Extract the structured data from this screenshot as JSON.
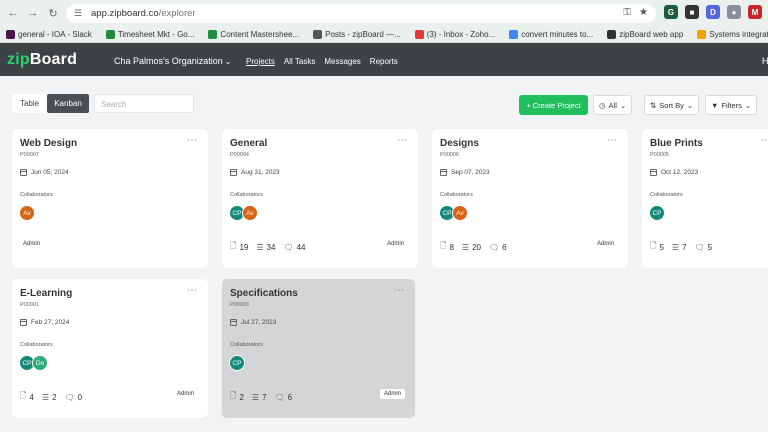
{
  "browser": {
    "url_host": "app.zipboard.co",
    "url_path": "/explorer",
    "bookmarks": [
      {
        "label": "general - IOA - Slack",
        "color": "#4a154b"
      },
      {
        "label": "Timesheet Mkt - Go...",
        "color": "#1e8e3e"
      },
      {
        "label": "Content Mastershee...",
        "color": "#1e8e3e"
      },
      {
        "label": "Posts - zipBoard —...",
        "color": "#555555"
      },
      {
        "label": "(3) - Inbox - Zoho...",
        "color": "#e53935"
      },
      {
        "label": "convert minutes to...",
        "color": "#4285f4"
      },
      {
        "label": "zipBoard web app",
        "color": "#333333"
      },
      {
        "label": "Systems integration...",
        "color": "#f4a100"
      }
    ]
  },
  "app": {
    "logo_zip": "zip",
    "logo_board": "Board",
    "organization": "Cha Palmos's Organization",
    "nav": [
      "Projects",
      "All Tasks",
      "Messages",
      "Reports"
    ],
    "header_right": "H"
  },
  "toolbar": {
    "table_label": "Table",
    "kanban_label": "Kanban",
    "search_placeholder": "Search",
    "create_label": "Create Project",
    "all_label": "All",
    "sort_label": "Sort By",
    "filters_label": "Filters"
  },
  "projects": [
    {
      "title": "Web Design",
      "code": "P00007",
      "date": "Jun 05, 2024",
      "collab_label": "Collaborators",
      "avatars": [
        "Av"
      ],
      "stats": null,
      "role": "Admin"
    },
    {
      "title": "General",
      "code": "P00004",
      "date": "Aug 31, 2023",
      "collab_label": "Collaborators",
      "avatars": [
        "CP",
        "Av"
      ],
      "stats": {
        "files": "19",
        "tasks": "34",
        "comments": "44"
      },
      "role": "Admin"
    },
    {
      "title": "Designs",
      "code": "P00006",
      "date": "Sep 07, 2023",
      "collab_label": "Collaborators",
      "avatars": [
        "CP",
        "Av"
      ],
      "stats": {
        "files": "8",
        "tasks": "20",
        "comments": "6"
      },
      "role": "Admin"
    },
    {
      "title": "Blue Prints",
      "code": "P00005",
      "date": "Oct 12, 2023",
      "collab_label": "Collaborators",
      "avatars": [
        "CP"
      ],
      "stats": {
        "files": "5",
        "tasks": "7",
        "comments": "5"
      },
      "role": ""
    },
    {
      "title": "E-Learning",
      "code": "P00001",
      "date": "Feb 27, 2024",
      "collab_label": "Collaborators",
      "avatars": [
        "CP",
        "Do"
      ],
      "stats": {
        "files": "4",
        "tasks": "2",
        "comments": "0"
      },
      "role": "Admin"
    },
    {
      "title": "Specifications",
      "code": "P00003",
      "date": "Jul 27, 2023",
      "collab_label": "Collaborators",
      "avatars": [
        "CP"
      ],
      "stats": {
        "files": "2",
        "tasks": "7",
        "comments": "6"
      },
      "role": "Admin"
    }
  ]
}
